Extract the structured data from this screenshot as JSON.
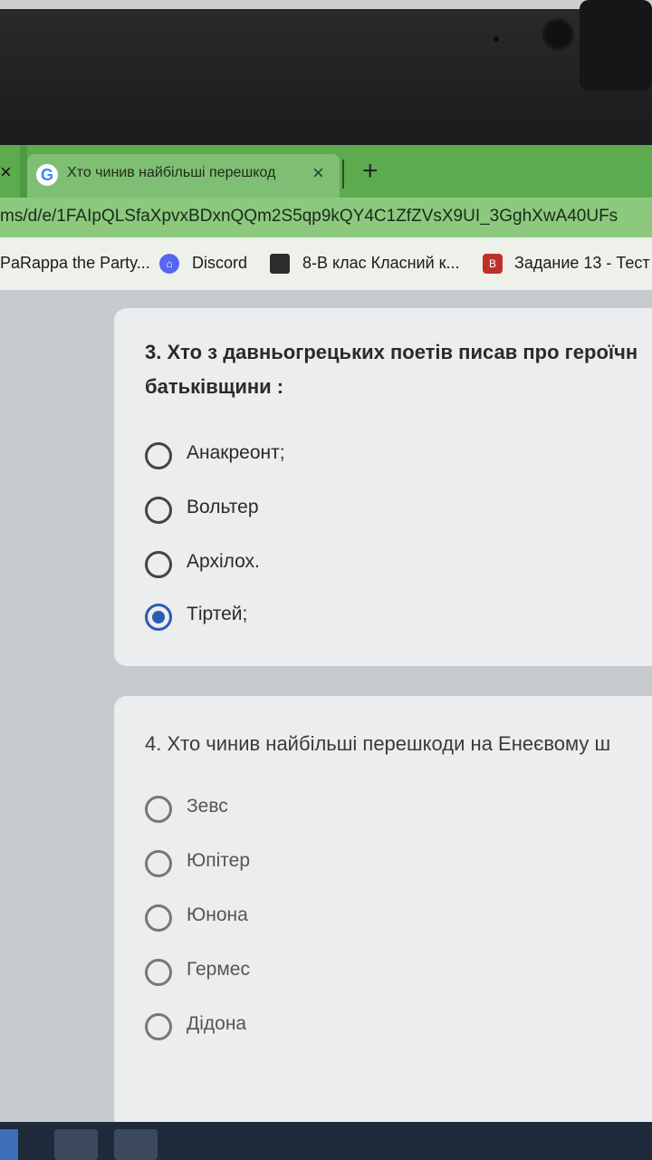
{
  "browser": {
    "prev_tab_close": "×",
    "tab": {
      "title": "Хто чинив найбільші перешкод",
      "close": "×",
      "favicon": "G"
    },
    "new_tab": "+",
    "url": "ms/d/e/1FAIpQLSfaXpvxBDxnQQm2S5qp9kQY4C1ZfZVsX9UI_3GghXwA40UFs",
    "bookmarks": [
      {
        "label": "PaRappa the Party..."
      },
      {
        "label": "Discord",
        "icon_text": "⌂"
      },
      {
        "label": "8-В клас Класний к..."
      },
      {
        "label": "Задание 13 - Тест",
        "icon_text": "В"
      }
    ]
  },
  "form": {
    "q3": {
      "line1": "3. Хто з давньогрецьких поетів писав про героїчн",
      "line2": "батьківщини :",
      "options": [
        "Анакреонт;",
        "Вольтер",
        "Архілох.",
        "Тіртей;"
      ],
      "selected_index": 3
    },
    "q4": {
      "text": "4. Хто чинив найбільші перешкоди на Енеєвому ш",
      "options": [
        "Зевс",
        "Юпітер",
        "Юнона",
        "Гермес",
        "Дідона"
      ]
    }
  },
  "colors": {
    "tab_green": "#5dab4f",
    "radio_selected": "#2b5bb4"
  }
}
